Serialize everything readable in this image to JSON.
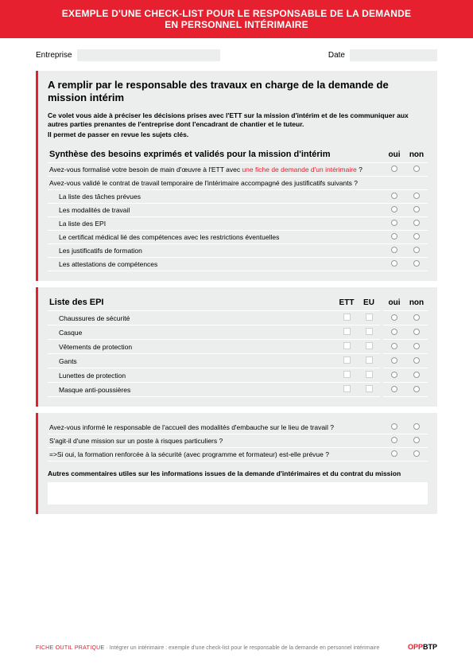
{
  "header": {
    "line1": "EXEMPLE D'UNE CHECK-LIST POUR LE RESPONSABLE DE LA DEMANDE",
    "line2": "EN PERSONNEL INTÉRIMAIRE"
  },
  "meta": {
    "entreprise_label": "Entreprise",
    "entreprise_value": "",
    "date_label": "Date",
    "date_value": ""
  },
  "section1": {
    "title": "A remplir par le responsable des travaux en charge de la demande de mission intérim",
    "intro1": "Ce volet vous aide à préciser les décisions prises avec l'ETT sur la mission d'intérim et de les communiquer aux autres parties prenantes de l'entreprise dont l'encadrant de chantier et le tuteur.",
    "intro2": "Il permet de passer en revue les sujets clés.",
    "table_heading": "Synthèse des besoins exprimés et validés pour la mission d'intérim",
    "col_oui": "oui",
    "col_non": "non",
    "row1_a": "Avez-vous formalisé votre besoin de main d'œuvre à l'ETT avec ",
    "row1_link": "une fiche de demande d'un intérimaire",
    "row1_b": " ?",
    "row2": "Avez-vous validé le contrat de travail temporaire de l'intérimaire accompagné des justificatifs suivants ?",
    "rows": [
      "La liste des tâches prévues",
      "Les modalités de travail",
      "La liste des EPI",
      "Le certificat médical lié des compétences avec les restrictions éventuelles",
      "Les justificatifs de formation",
      "Les attestations de compétences"
    ]
  },
  "section2": {
    "heading": "Liste des EPI",
    "col_ett": "ETT",
    "col_eu": "EU",
    "col_oui": "oui",
    "col_non": "non",
    "rows": [
      "Chaussures de sécurité",
      "Casque",
      "Vêtements de protection",
      "Gants",
      "Lunettes de protection",
      "Masque anti-poussières"
    ]
  },
  "section3": {
    "rows": [
      "Avez-vous informé le responsable de l'accueil des modalités d'embauche sur le lieu de travail ?",
      "S'agit-il d'une mission sur un poste à risques particuliers ?",
      "=>Si oui, la formation renforcée à la sécurité (avec programme et formateur) est-elle prévue ?"
    ],
    "comments_label": "Autres commentaires utiles sur les informations issues de la demande d'intérimaires et du contrat du mission"
  },
  "footer": {
    "red_prefix": "FICHE OUTIL PRATIQUE",
    "grey_text": " · Intégrer un intérimaire : exemple d'une check-list pour le responsable de la demande en personnel intérimaire",
    "brand_opp": "OPP",
    "brand_btp": "BTP"
  },
  "chart_data": {
    "type": "table",
    "tables": [
      {
        "title": "Synthèse des besoins exprimés et validés pour la mission d'intérim",
        "columns": [
          "question",
          "oui",
          "non"
        ],
        "rows": [
          [
            "Avez-vous formalisé votre besoin de main d'œuvre à l'ETT avec une fiche de demande d'un intérimaire ?",
            null,
            null
          ],
          [
            "Avez-vous validé le contrat de travail temporaire de l'intérimaire accompagné des justificatifs suivants ?",
            null,
            null
          ],
          [
            "La liste des tâches prévues",
            null,
            null
          ],
          [
            "Les modalités de travail",
            null,
            null
          ],
          [
            "La liste des EPI",
            null,
            null
          ],
          [
            "Le certificat médical lié des compétences avec les restrictions éventuelles",
            null,
            null
          ],
          [
            "Les justificatifs de formation",
            null,
            null
          ],
          [
            "Les attestations de compétences",
            null,
            null
          ]
        ]
      },
      {
        "title": "Liste des EPI",
        "columns": [
          "item",
          "ETT",
          "EU",
          "oui",
          "non"
        ],
        "rows": [
          [
            "Chaussures de sécurité",
            null,
            null,
            null,
            null
          ],
          [
            "Casque",
            null,
            null,
            null,
            null
          ],
          [
            "Vêtements de protection",
            null,
            null,
            null,
            null
          ],
          [
            "Gants",
            null,
            null,
            null,
            null
          ],
          [
            "Lunettes de protection",
            null,
            null,
            null,
            null
          ],
          [
            "Masque anti-poussières",
            null,
            null,
            null,
            null
          ]
        ]
      },
      {
        "title": "Questions complémentaires",
        "columns": [
          "question",
          "oui",
          "non"
        ],
        "rows": [
          [
            "Avez-vous informé le responsable de l'accueil des modalités d'embauche sur le lieu de travail ?",
            null,
            null
          ],
          [
            "S'agit-il d'une mission sur un poste à risques particuliers ?",
            null,
            null
          ],
          [
            "=>Si oui, la formation renforcée à la sécurité (avec programme et formateur) est-elle prévue ?",
            null,
            null
          ]
        ]
      }
    ]
  }
}
